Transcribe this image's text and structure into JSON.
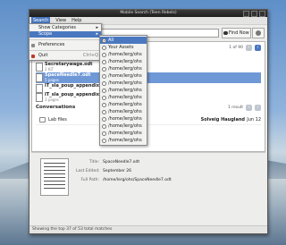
{
  "window": {
    "title": "Mobile Search (Teen Rebels)"
  },
  "menubar": [
    "Search",
    "View",
    "Help"
  ],
  "toolbar": {
    "find_now": "Find Now"
  },
  "files": {
    "nav": "1 of 90",
    "items": [
      {
        "name": "Secretarywage.odt",
        "sub": "2 KiT"
      },
      {
        "name": "SpaceNeedle7.odt",
        "sub": "5 pages"
      },
      {
        "name": "IT_sla_poup_appendix.pdf",
        "sub": ""
      },
      {
        "name": "IT_sla_poup_appendix_9.xsw",
        "sub": "3 pages"
      }
    ]
  },
  "conversations": {
    "heading": "Conversations",
    "nav": "1 result",
    "item": {
      "from": "Lab files",
      "person": "Solveig Haugland",
      "date": "Jun 12"
    }
  },
  "preview": {
    "title_label": "Title:",
    "title_value": "SpaceNeedle7.odt",
    "edited_label": "Last Edited:",
    "edited_value": "September 26",
    "path_label": "Full Path:",
    "path_value": "/home/lerg/ohs/SpaceNeedle7.odt"
  },
  "status": "Showing the top 37 of 53 total matches",
  "menu": {
    "items": [
      {
        "label": "Show Categories",
        "arrow": "▸"
      },
      {
        "label": "Scope",
        "arrow": "▸",
        "highlight": true
      },
      {
        "label": "Preferences"
      },
      {
        "label": "Quit",
        "shortcut": "Ctrl+Q"
      }
    ]
  },
  "scope": {
    "items": [
      "All",
      "Your Assets",
      "/home/lerg/ohs",
      "/home/lerg/ohs",
      "/home/lerg/ohs",
      "/home/lerg/ohs",
      "/home/lerg/ohs",
      "/home/lerg/ohs",
      "/home/lerg/ohs",
      "/home/lerg/ohs",
      "/home/lerg/ohs",
      "/home/lerg/ohs",
      "/home/lerg/ohs",
      "/home/lerg/ohs",
      "/home/lerg/ohs"
    ]
  }
}
